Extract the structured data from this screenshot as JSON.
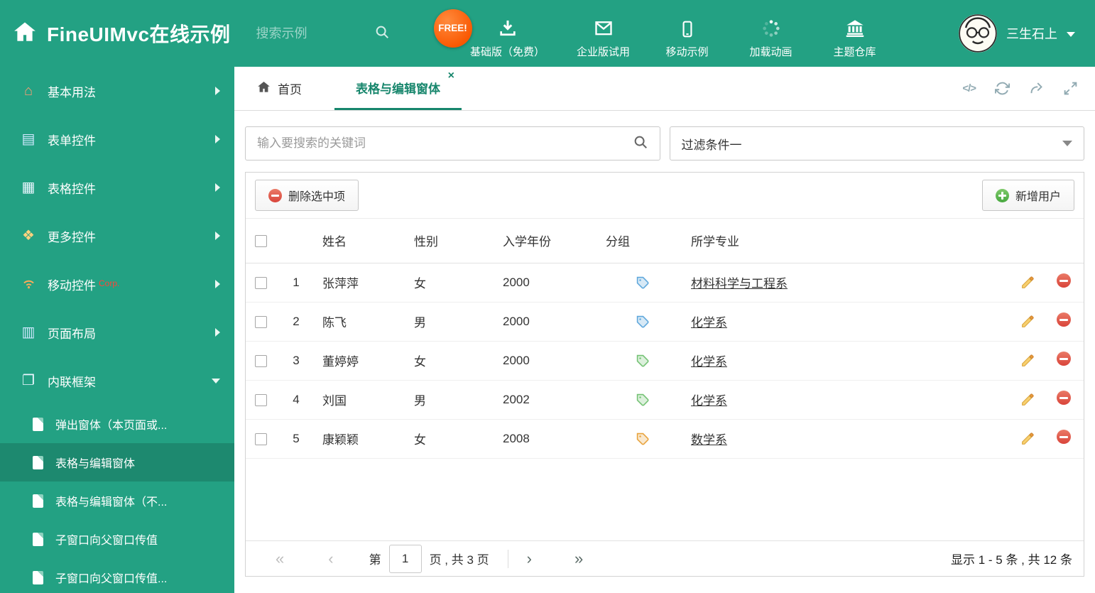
{
  "colors": {
    "theme": "#23a183",
    "tab_accent": "#17866c",
    "free_badge": "#f95700",
    "delete_red": "#d9443a",
    "add_green": "#47a83f",
    "tag_blue": "#5fa8dc",
    "tag_green": "#74c274",
    "tag_orange": "#e8a33d"
  },
  "icons": {
    "code": "</>",
    "close": "×",
    "home_glyph": "⌂",
    "form_glyph": "▤",
    "grid_glyph": "▦",
    "more_glyph": "❖",
    "layout_glyph": "▥",
    "frame_glyph": "❐",
    "first": "«",
    "prev": "‹",
    "next": "›",
    "last": "»"
  },
  "header": {
    "title": "FineUIMvc在线示例",
    "search_placeholder": "搜索示例",
    "free_badge": "FREE!",
    "nav_items": [
      {
        "label": "基础版（免费）"
      },
      {
        "label": "企业版试用"
      },
      {
        "label": "移动示例"
      },
      {
        "label": "加载动画"
      },
      {
        "label": "主题仓库"
      }
    ],
    "username": "三生石上"
  },
  "sidebar": {
    "items": [
      {
        "label": "基本用法"
      },
      {
        "label": "表单控件"
      },
      {
        "label": "表格控件"
      },
      {
        "label": "更多控件"
      },
      {
        "label": "移动控件",
        "badge": "Corp."
      },
      {
        "label": "页面布局"
      },
      {
        "label": "内联框架"
      }
    ],
    "subitems": [
      {
        "label": "弹出窗体（本页面或..."
      },
      {
        "label": "表格与编辑窗体"
      },
      {
        "label": "表格与编辑窗体（不..."
      },
      {
        "label": "子窗口向父窗口传值"
      },
      {
        "label": "子窗口向父窗口传值..."
      }
    ]
  },
  "tabs": {
    "home": "首页",
    "active": "表格与编辑窗体"
  },
  "filters": {
    "search_placeholder": "输入要搜索的关键词",
    "filter_value": "过滤条件一"
  },
  "toolbar": {
    "delete_label": "删除选中项",
    "add_label": "新增用户"
  },
  "table": {
    "columns": {
      "name": "姓名",
      "gender": "性别",
      "year": "入学年份",
      "group": "分组",
      "major": "所学专业"
    },
    "rows": [
      {
        "index": "1",
        "name": "张萍萍",
        "gender": "女",
        "year": "2000",
        "major": "材料科学与工程系",
        "tag_style": "color:#5fa8dc"
      },
      {
        "index": "2",
        "name": "陈飞",
        "gender": "男",
        "year": "2000",
        "major": "化学系",
        "tag_style": "color:#5fa8dc"
      },
      {
        "index": "3",
        "name": "董婷婷",
        "gender": "女",
        "year": "2000",
        "major": "化学系",
        "tag_style": "color:#74c274"
      },
      {
        "index": "4",
        "name": "刘国",
        "gender": "男",
        "year": "2002",
        "major": "化学系",
        "tag_style": "color:#74c274"
      },
      {
        "index": "5",
        "name": "康颖颖",
        "gender": "女",
        "year": "2008",
        "major": "数学系",
        "tag_style": "color:#e8a33d"
      }
    ]
  },
  "pagination": {
    "page_prefix": "第",
    "current_page": "1",
    "page_suffix": "页 , 共 3 页",
    "summary": "显示 1 - 5 条 , 共 12 条"
  }
}
